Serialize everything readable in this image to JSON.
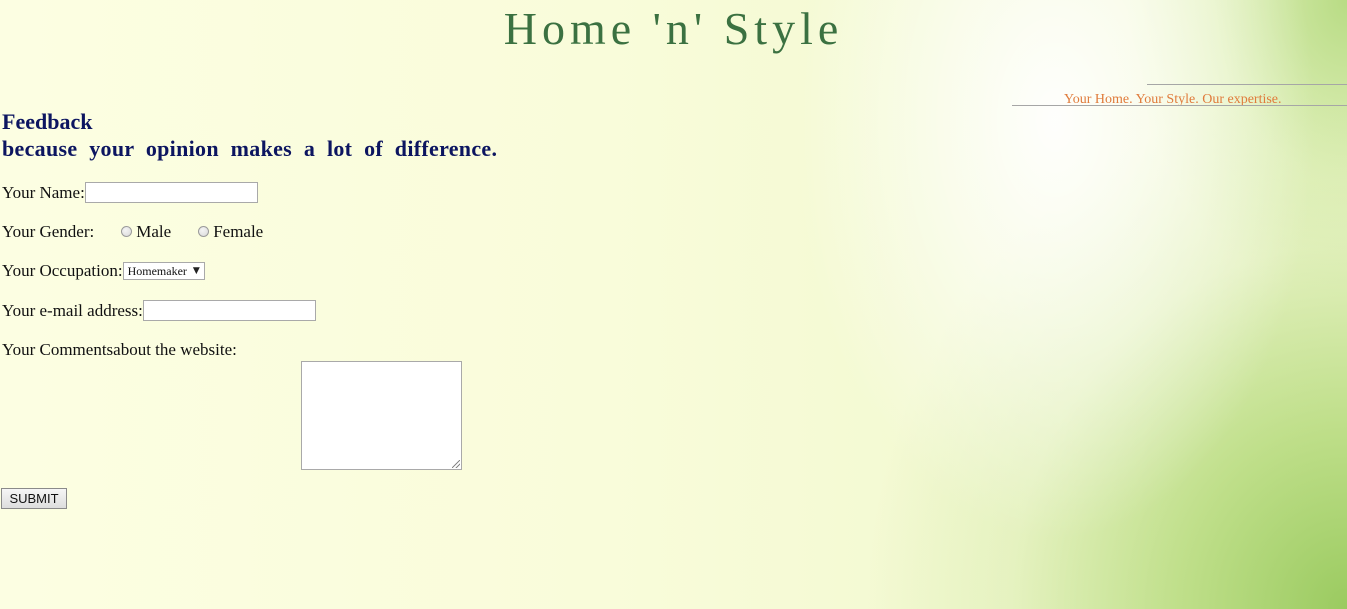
{
  "header": {
    "site_title": "Home 'n' Style",
    "tagline": "Your Home. Your Style. Our expertise."
  },
  "feedback": {
    "heading": "Feedback",
    "subheading": "because your opinion makes a lot of difference."
  },
  "form": {
    "name_label": "Your Name:",
    "name_value": "",
    "gender_label": "Your Gender:",
    "gender_options": [
      "Male",
      "Female"
    ],
    "occupation_label": "Your Occupation:",
    "occupation_selected": "Homemaker",
    "email_label": "Your e-mail address:",
    "email_value": "",
    "comments_label": "Your Commentsabout the website:",
    "comments_value": "",
    "submit_label": "SUBMIT"
  },
  "colors": {
    "title": "#3b7141",
    "tagline": "#e07b3b",
    "heading": "#0c1560"
  }
}
